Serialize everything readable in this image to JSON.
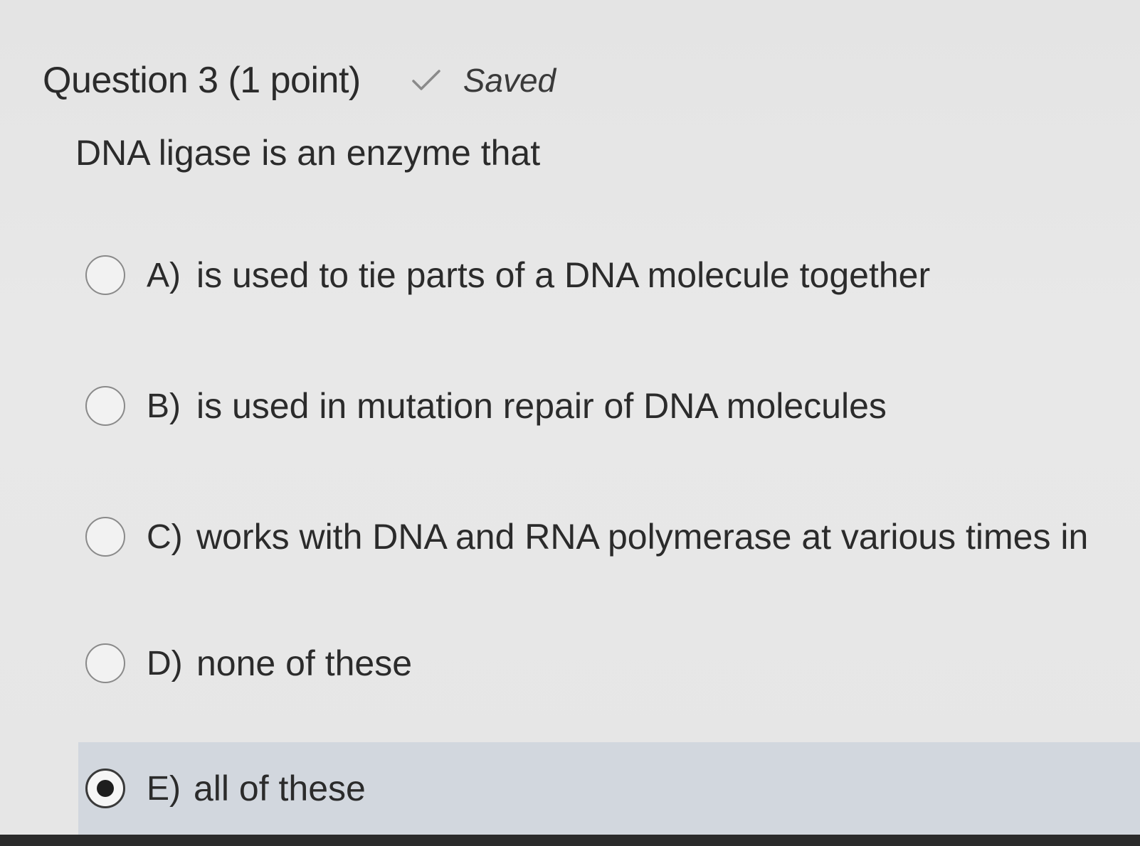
{
  "question": {
    "title": "Question 3 (1 point)",
    "status": "Saved",
    "stem": "DNA ligase is an enzyme that"
  },
  "options": [
    {
      "letter": "A)",
      "text": "is used to tie parts of a DNA molecule together",
      "selected": false
    },
    {
      "letter": "B)",
      "text": "is used in mutation repair of DNA molecules",
      "selected": false
    },
    {
      "letter": "C)",
      "text": "works with DNA and RNA polymerase at various times in",
      "selected": false
    },
    {
      "letter": "D)",
      "text": "none of these",
      "selected": false
    },
    {
      "letter": "E)",
      "text": "all of these",
      "selected": true
    }
  ],
  "colors": {
    "background": "#e6e6e6",
    "selected_highlight": "#d2d7de",
    "text": "#2b2b2b"
  }
}
